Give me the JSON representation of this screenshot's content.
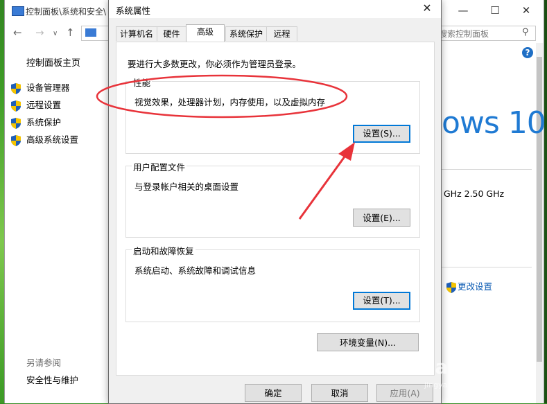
{
  "background_window": {
    "title": "控制面板\\系统和安全\\",
    "search_placeholder": "搜索控制面板",
    "home": "控制面板主页",
    "sidebar_items": [
      "设备管理器",
      "远程设置",
      "系统保护",
      "高级系统设置"
    ],
    "see_also": "另请参阅",
    "security": "安全性与维护",
    "windows_text": "ows 10",
    "cpu_speed": "GHz   2.50 GHz",
    "change_settings": "更改设置",
    "help_label": "?"
  },
  "dialog": {
    "title": "系统属性",
    "tabs": [
      "计算机名",
      "硬件",
      "高级",
      "系统保护",
      "远程"
    ],
    "active_tab": 2,
    "admin_note": "要进行大多数更改，你必须作为管理员登录。",
    "groups": [
      {
        "label": "性能",
        "desc": "视觉效果，处理器计划，内存使用，以及虚拟内存",
        "button": "设置(S)..."
      },
      {
        "label": "用户配置文件",
        "desc": "与登录帐户相关的桌面设置",
        "button": "设置(E)..."
      },
      {
        "label": "启动和故障恢复",
        "desc": "系统启动、系统故障和调试信息",
        "button": "设置(T)..."
      }
    ],
    "env_button": "环境变量(N)...",
    "ok": "确定",
    "cancel": "取消",
    "apply": "应用(A)"
  },
  "watermark": {
    "brand": "Bai  经验",
    "site": "jingyan.baidu.com"
  },
  "colors": {
    "annotation": "#e8333a",
    "accent": "#0078d7",
    "shield_blue": "#1f5fb8",
    "shield_yellow": "#f5c400"
  }
}
